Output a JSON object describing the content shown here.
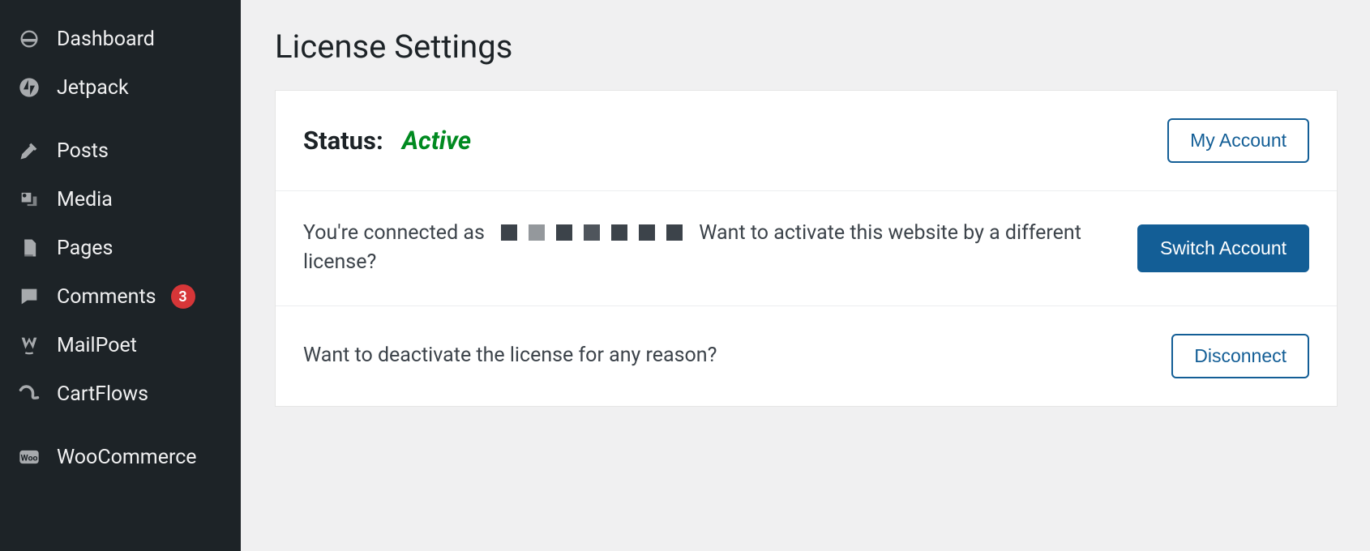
{
  "sidebar": {
    "items": [
      {
        "label": "Dashboard",
        "icon": "dashboard-icon"
      },
      {
        "label": "Jetpack",
        "icon": "jetpack-icon"
      },
      {
        "label": "Posts",
        "icon": "posts-icon"
      },
      {
        "label": "Media",
        "icon": "media-icon"
      },
      {
        "label": "Pages",
        "icon": "pages-icon"
      },
      {
        "label": "Comments",
        "icon": "comments-icon",
        "badge": "3"
      },
      {
        "label": "MailPoet",
        "icon": "mailpoet-icon"
      },
      {
        "label": "CartFlows",
        "icon": "cartflows-icon"
      },
      {
        "label": "WooCommerce",
        "icon": "woocommerce-icon"
      }
    ]
  },
  "page": {
    "title": "License Settings"
  },
  "status": {
    "label": "Status:",
    "value": "Active"
  },
  "buttons": {
    "my_account": "My Account",
    "switch_account": "Switch Account",
    "disconnect": "Disconnect"
  },
  "connected": {
    "prefix": "You're connected as",
    "suffix": "Want to activate this website by a different license?"
  },
  "deactivate": {
    "text": "Want to deactivate the license for any reason?"
  }
}
